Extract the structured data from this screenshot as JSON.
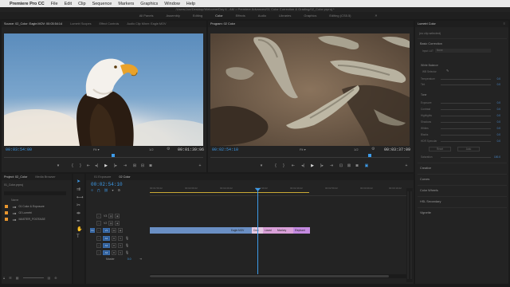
{
  "menubar": {
    "app": "Premiere Pro CC",
    "items": [
      "File",
      "Edit",
      "Clip",
      "Sequence",
      "Markers",
      "Graphics",
      "Window",
      "Help"
    ]
  },
  "titlebar": {
    "path": "/Users/Joe/Desktop/Welcome/Day 6 - AM > Premiere Advanced/01 Color Correction & Grading/02_Color.prproj *"
  },
  "workspaces": {
    "items": [
      "All Panels",
      "Assembly",
      "Editing",
      "Color",
      "Effects",
      "Audio",
      "Libraries",
      "Graphics",
      "Editing (CS5.5)"
    ],
    "active": "Color",
    "overflow": "»"
  },
  "source_monitor": {
    "tabs": [
      "Source: 02_Color: Eagle.MOV: 00:03:54:14",
      "Lumetri Scopes",
      "Effect Controls",
      "Audio Clip Mixer: Eagle.MOV"
    ],
    "timecode_current": "00:03:54:00",
    "timecode_duration": "00:01:39:06",
    "fraction": "1/2",
    "fit": "Fit"
  },
  "program_monitor": {
    "tabs": [
      "Program: 02 Color"
    ],
    "timecode_current": "00:02:54:10",
    "timecode_duration": "00:03:37:09",
    "fraction": "1/2",
    "fit": "Fit"
  },
  "lumetri": {
    "tabs": [
      "Lumetri Color"
    ],
    "no_clip": "(no clip selected)",
    "sections": [
      "Basic Correction",
      "Creative",
      "Curves",
      "Color Wheels",
      "HSL Secondary",
      "Vignette"
    ],
    "basic": {
      "input_lut": "Input LUT",
      "input_lut_value": "None",
      "white_balance": "White Balance",
      "wb_selector": "WB Selector",
      "sliders_wb": [
        {
          "label": "Temperature",
          "value": "0.0"
        },
        {
          "label": "Tint",
          "value": "0.0"
        }
      ],
      "tone": "Tone",
      "sliders_tone": [
        {
          "label": "Exposure",
          "value": "0.0"
        },
        {
          "label": "Contrast",
          "value": "0.0"
        },
        {
          "label": "Highlights",
          "value": "0.0"
        },
        {
          "label": "Shadows",
          "value": "0.0"
        },
        {
          "label": "Whites",
          "value": "0.0"
        },
        {
          "label": "Blacks",
          "value": "0.0"
        },
        {
          "label": "HDR Specular",
          "value": "0.0"
        }
      ],
      "reset": "Reset",
      "auto": "Auto",
      "saturation": "Saturation",
      "saturation_value": "100.0"
    }
  },
  "project": {
    "tabs": [
      "Project: 02_Color",
      "Media Browser"
    ],
    "bin_path": "01_Color.prproj",
    "column_header": "Name",
    "items": [
      {
        "name": "01 Color & Exposure",
        "color": "#e8962f"
      },
      {
        "name": "02 Lumetri",
        "color": "#e8962f"
      },
      {
        "name": "MASTER_FOOTAGE",
        "color": "#e8962f"
      }
    ]
  },
  "timeline": {
    "tabs": [
      "01 Exposure",
      "02 Color"
    ],
    "timecode": "00:02:54:10",
    "ruler": [
      "00:01:59:22",
      "00:02:09:22",
      "00:02:29:22",
      "00:02:39:22",
      "00:02:49:22",
      "00:02:59:22",
      "00:03:09:22",
      "00:03:19:22"
    ],
    "video_tracks": [
      "V3",
      "V2",
      "V1"
    ],
    "audio_tracks": [
      "A1",
      "A2",
      "A3"
    ],
    "master": "Master",
    "master_value": "0.0",
    "clips": [
      {
        "name": "Eagle.MOV",
        "color": "#6a8fc4"
      },
      {
        "name": "Croc",
        "color": "#d9a0d8"
      },
      {
        "name": "Lizard",
        "color": "#d9a0d8"
      },
      {
        "name": "Monkey",
        "color": "#d9a0d8"
      },
      {
        "name": "Elephant",
        "color": "#c48ae0"
      }
    ]
  },
  "tools": [
    "selection",
    "track-select",
    "ripple",
    "razor",
    "slip",
    "pen",
    "hand",
    "type"
  ],
  "icons": {
    "play": "play-icon",
    "step_back": "step-back-icon",
    "step_forward": "step-forward-icon",
    "mark_in": "mark-in-icon",
    "mark_out": "mark-out-icon",
    "export_frame": "camera-icon",
    "wrench": "wrench-icon"
  },
  "accent": "#3d9be9"
}
